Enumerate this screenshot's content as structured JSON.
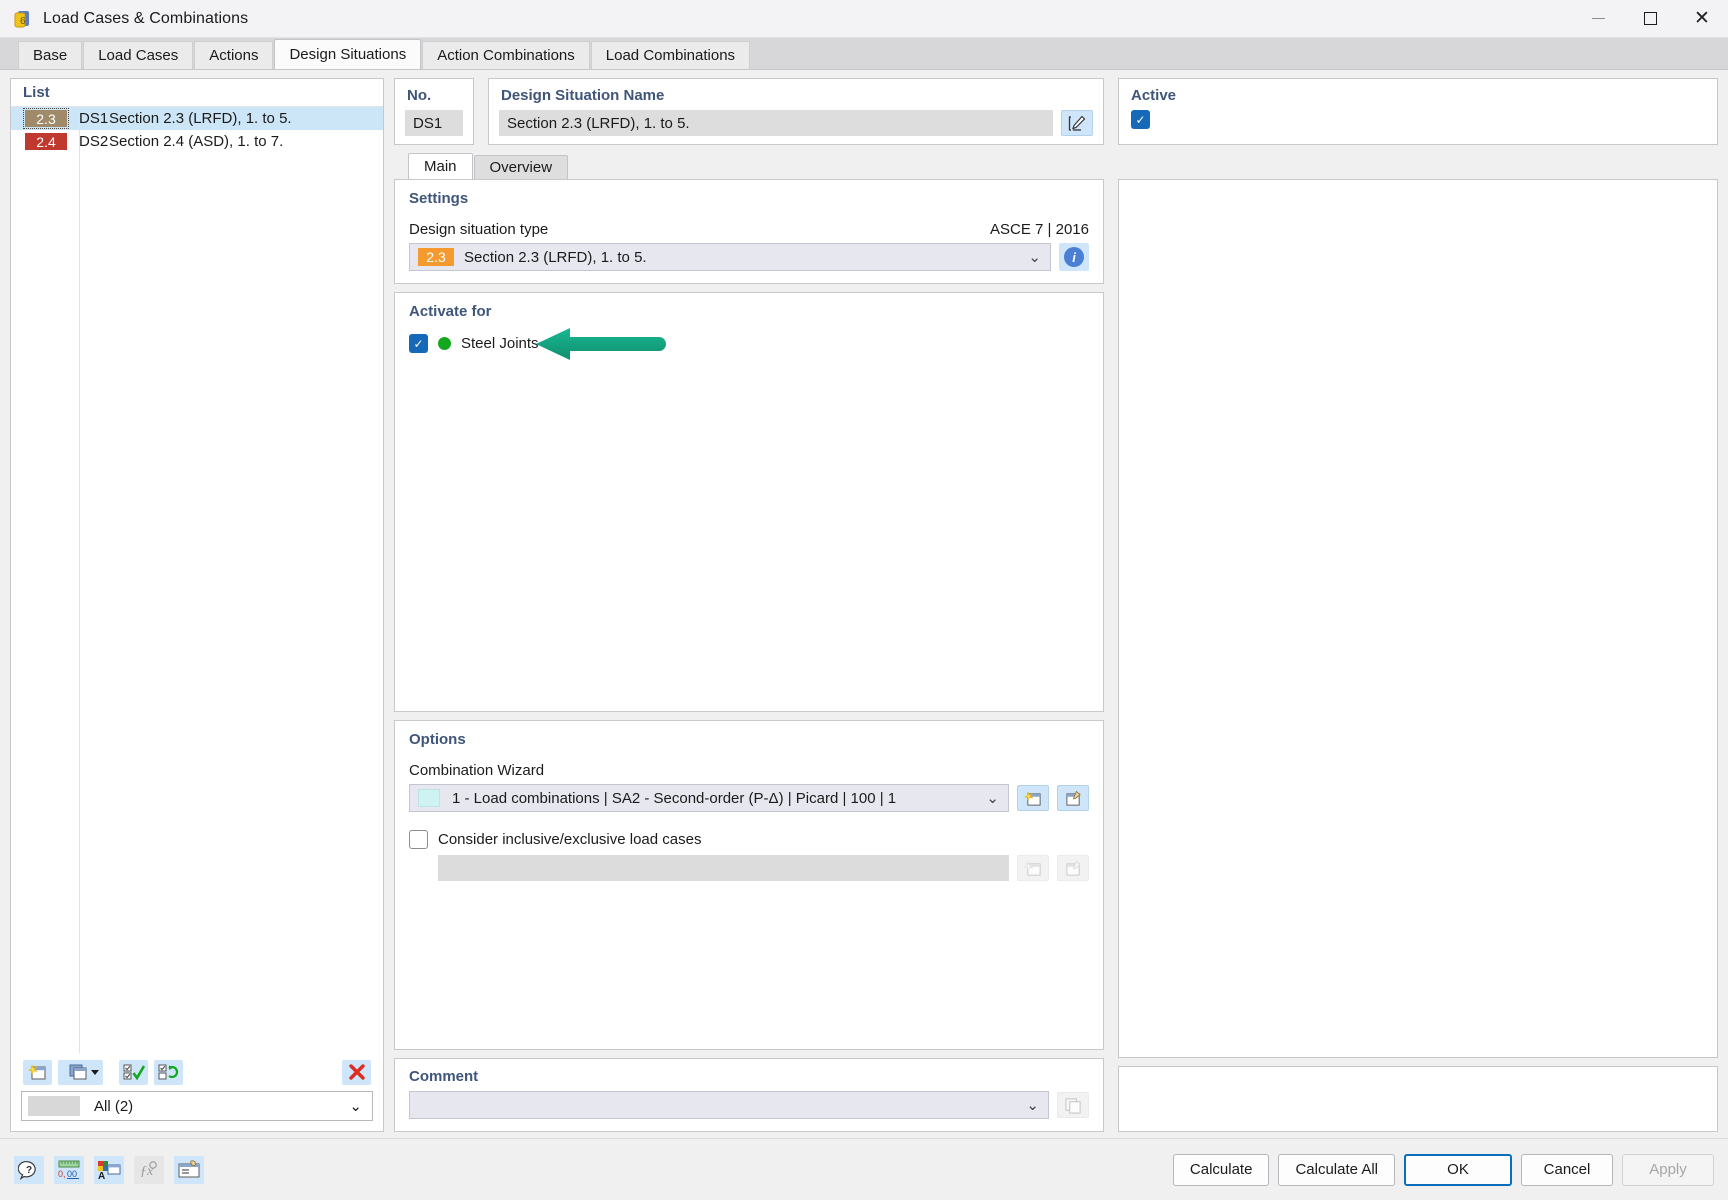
{
  "window": {
    "title": "Load Cases & Combinations",
    "icon": "load-combinations-icon",
    "minimize": "—",
    "maximize": "□",
    "close": "✕"
  },
  "tabs": [
    {
      "label": "Base",
      "active": false
    },
    {
      "label": "Load Cases",
      "active": false
    },
    {
      "label": "Actions",
      "active": false
    },
    {
      "label": "Design Situations",
      "active": true
    },
    {
      "label": "Action Combinations",
      "active": false
    },
    {
      "label": "Load Combinations",
      "active": false
    }
  ],
  "list": {
    "title": "List",
    "rows": [
      {
        "badge": "2.3",
        "badge_color": "#a08a6a",
        "no": "DS1",
        "name": "Section 2.3 (LRFD), 1. to 5.",
        "selected": true
      },
      {
        "badge": "2.4",
        "badge_color": "#c0392f",
        "no": "DS2",
        "name": "Section 2.4 (ASD), 1. to 7.",
        "selected": false
      }
    ],
    "toolbar": [
      {
        "name": "new-item-button",
        "glyph": "✦"
      },
      {
        "name": "copy-item-dropdown-button",
        "glyph": "❐"
      },
      {
        "name": "select-all-button",
        "glyph": "✔"
      },
      {
        "name": "invert-selection-button",
        "glyph": "⟳"
      },
      {
        "name": "delete-item-button",
        "glyph": "✕"
      }
    ],
    "filter": "All (2)"
  },
  "no_card": {
    "title": "No.",
    "value": "DS1"
  },
  "name_card": {
    "title": "Design Situation Name",
    "value": "Section 2.3 (LRFD), 1. to 5.",
    "edit_button": "edit-name-icon"
  },
  "active_card": {
    "title": "Active",
    "checked": true
  },
  "inner_tabs": [
    {
      "label": "Main",
      "active": true
    },
    {
      "label": "Overview",
      "active": false
    }
  ],
  "settings": {
    "title": "Settings",
    "label": "Design situation type",
    "standard": "ASCE 7 | 2016",
    "value_badge": "2.3",
    "value_badge_color": "#f59a2e",
    "value": "Section 2.3 (LRFD), 1. to 5.",
    "info_icon": "info-icon"
  },
  "activate_for": {
    "title": "Activate for",
    "items": [
      {
        "label": "Steel Joints",
        "checked": true,
        "dot_color": "#14a81e"
      }
    ]
  },
  "options": {
    "title": "Options",
    "wizard_label": "Combination Wizard",
    "wizard_value": "1 - Load combinations | SA2 - Second-order (P-Δ) | Picard | 100 | 1",
    "wizard_new_button": "new-wizard-icon",
    "wizard_edit_button": "edit-wizard-icon",
    "consider_label": "Consider inclusive/exclusive load cases",
    "consider_checked": false,
    "consider_value": "",
    "consider_new_button": "new-inclusive-icon",
    "consider_edit_button": "edit-inclusive-icon"
  },
  "comment": {
    "title": "Comment",
    "value": "",
    "copy_button": "copy-comment-icon"
  },
  "footer": {
    "icons": [
      {
        "name": "help-icon",
        "enabled": true
      },
      {
        "name": "units-icon",
        "label": "0,00",
        "enabled": true
      },
      {
        "name": "display-properties-icon",
        "enabled": true
      },
      {
        "name": "formula-icon",
        "label": "ƒx",
        "enabled": false
      },
      {
        "name": "table-settings-icon",
        "enabled": true
      }
    ],
    "buttons": [
      {
        "label": "Calculate",
        "style": "normal"
      },
      {
        "label": "Calculate All",
        "style": "normal"
      },
      {
        "label": "OK",
        "style": "primary"
      },
      {
        "label": "Cancel",
        "style": "normal"
      },
      {
        "label": "Apply",
        "style": "disabled"
      }
    ]
  },
  "annotation": {
    "arrow_color": "#13a37f",
    "arrow_direction": "left",
    "points_at": "Steel Joints"
  }
}
